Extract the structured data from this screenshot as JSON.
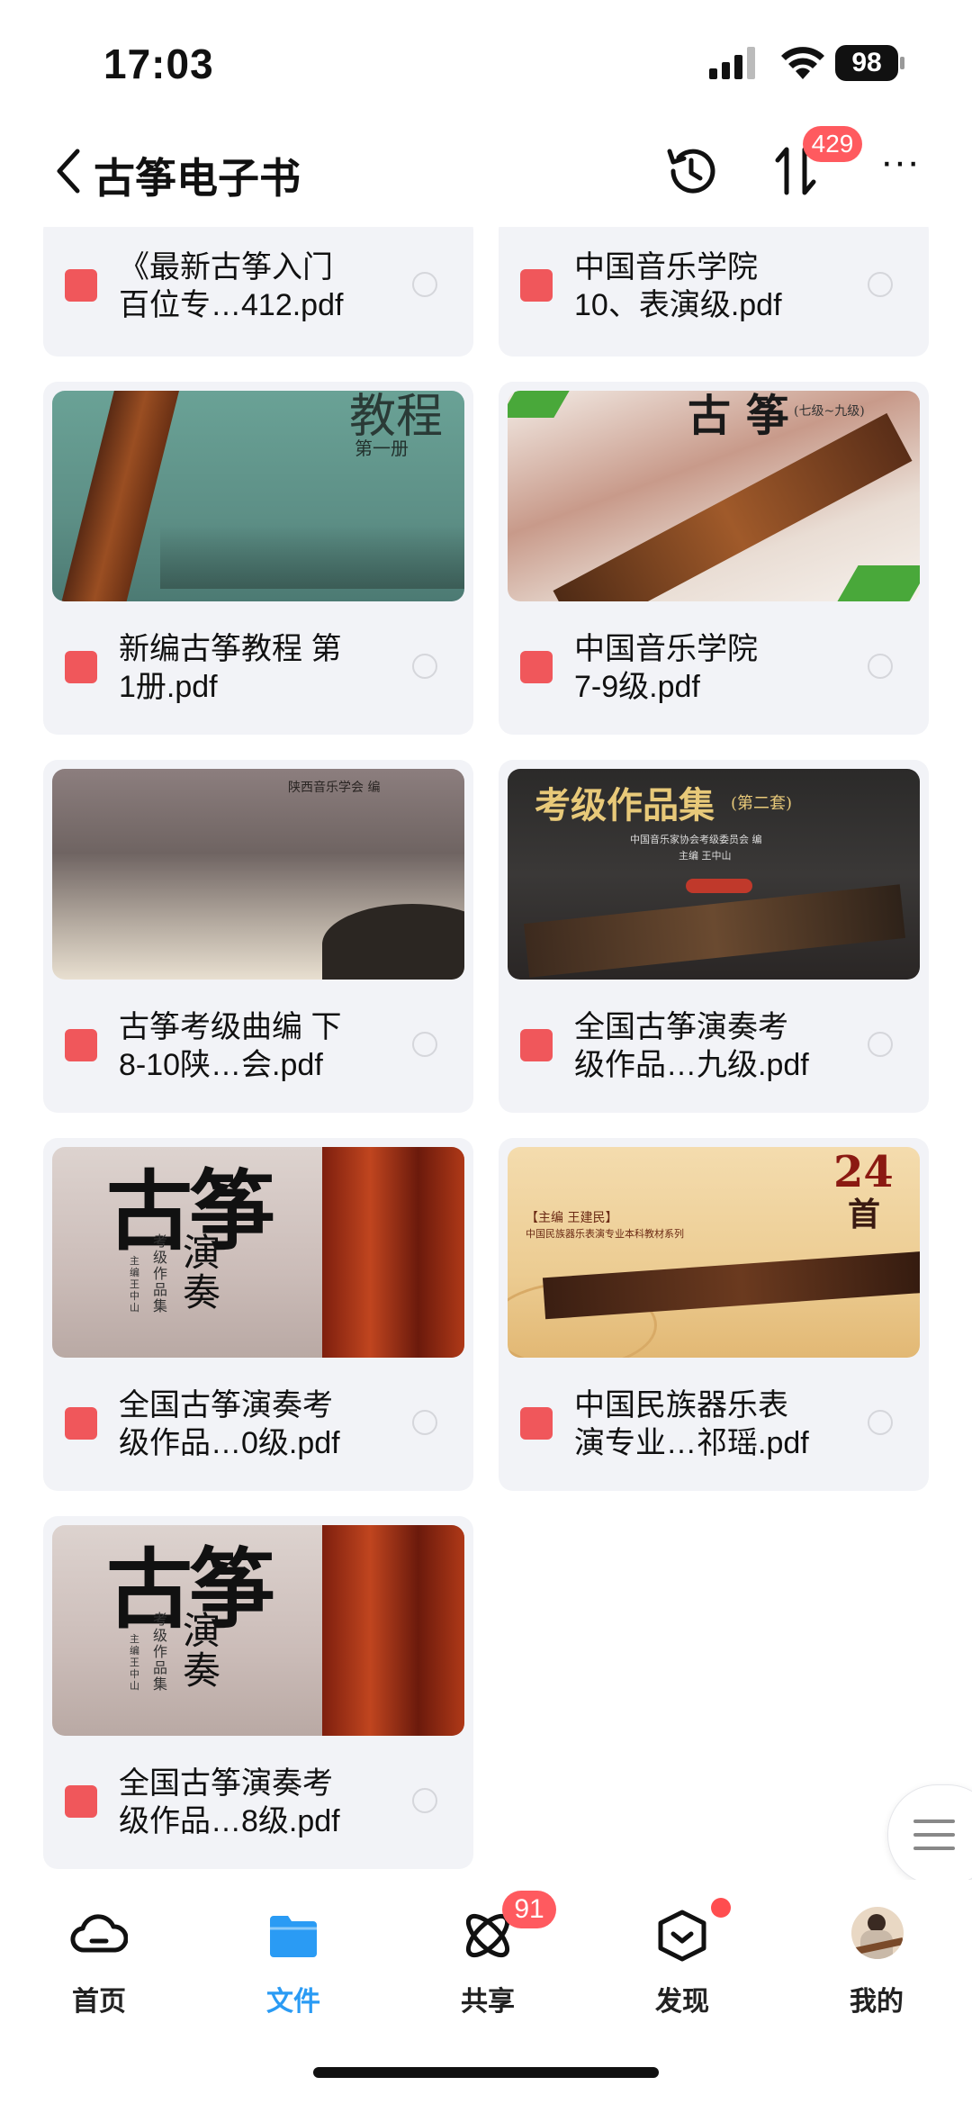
{
  "status_bar": {
    "time": "17:03",
    "battery": "98"
  },
  "header": {
    "title": "古筝电子书",
    "sort_badge": "429",
    "more": "···"
  },
  "files": [
    {
      "name": "《最新古筝入门\n百位专…412.pdf"
    },
    {
      "name": "中国音乐学院\n10、表演级.pdf"
    },
    {
      "name": "新编古筝教程  第\n1册.pdf",
      "thumb_title": "教程",
      "thumb_sub": "第一册"
    },
    {
      "name": "中国音乐学院\n7-9级.pdf",
      "thumb_title": "古 筝",
      "thumb_sub": "(七级~九级)"
    },
    {
      "name": "古筝考级曲编 下\n8-10陕…会.pdf",
      "thumb_sub": "陕西音乐学会 编"
    },
    {
      "name": "全国古筝演奏考\n级作品…九级.pdf",
      "thumb_title": "考级作品集",
      "thumb_sub": "(第二套)",
      "thumb_note": "中国音乐家协会考级委员会 编",
      "thumb_author": "主编 王中山"
    },
    {
      "name": "全国古筝演奏考\n级作品…0级.pdf",
      "thumb_title": "古筝",
      "thumb_sub": "演奏",
      "thumb_note": "考级作品集",
      "thumb_author": "主编 王中山"
    },
    {
      "name": "中国民族器乐表\n演专业…祁瑶.pdf",
      "thumb_title": "24",
      "thumb_sub": "首",
      "thumb_note": "【主编 王建民】",
      "thumb_author": "中国民族器乐表演专业本科教材系列"
    },
    {
      "name": "全国古筝演奏考\n级作品…8级.pdf",
      "thumb_title": "古筝",
      "thumb_sub": "演奏",
      "thumb_note": "考级作品集",
      "thumb_author": "主编 王中山"
    }
  ],
  "tabbar": {
    "items": [
      {
        "label": "首页"
      },
      {
        "label": "文件"
      },
      {
        "label": "共享",
        "badge": "91"
      },
      {
        "label": "发现"
      },
      {
        "label": "我的"
      }
    ]
  },
  "colors": {
    "accent": "#2a9bf4",
    "badge": "#ff5a5f",
    "pdf": "#f0575b",
    "card_bg": "#f2f3f7"
  },
  "icons": {
    "back": "chevron-left-icon",
    "history": "history-icon",
    "sort": "sort-icon",
    "more": "more-icon",
    "pdf": "pdf-icon",
    "home": "cloud-icon",
    "files": "folder-icon",
    "share": "share-icon",
    "discover": "discover-icon",
    "menu": "menu-icon"
  }
}
